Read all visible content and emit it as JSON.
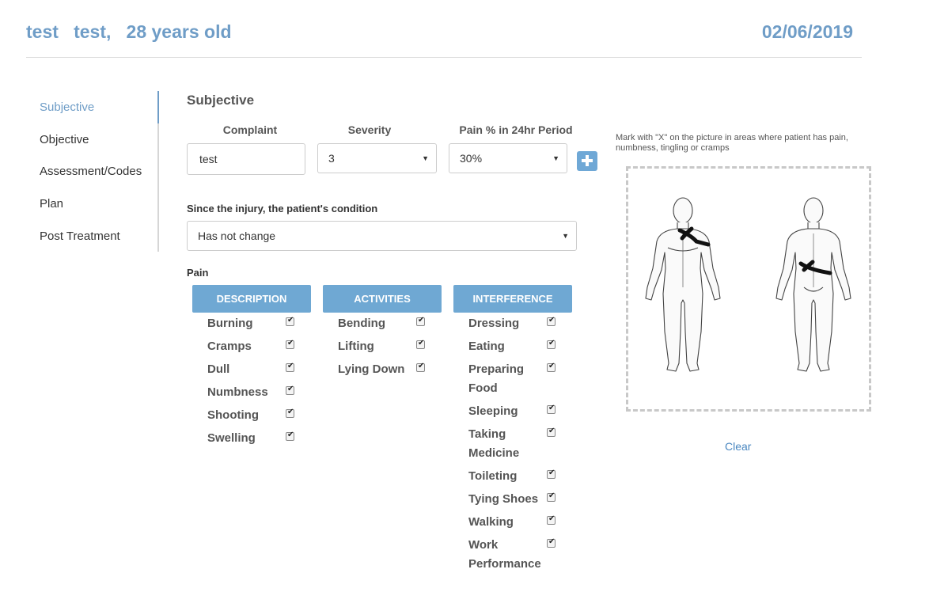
{
  "header": {
    "patient_name": "test   test,   28 years old",
    "visit_date": "02/06/2019"
  },
  "sidebar": {
    "items": [
      {
        "label": "Subjective",
        "active": true
      },
      {
        "label": "Objective",
        "active": false
      },
      {
        "label": "Assessment/Codes",
        "active": false
      },
      {
        "label": "Plan",
        "active": false
      },
      {
        "label": "Post Treatment",
        "active": false
      }
    ]
  },
  "subjective": {
    "title": "Subjective",
    "complaint_header": "Complaint",
    "severity_header": "Severity",
    "pain_percent_header": "Pain % in 24hr Period",
    "complaint_value": "test",
    "severity_value": "3",
    "pain_percent_value": "30%",
    "condition_label": "Since the injury, the patient's condition",
    "condition_value": "Has not change",
    "pain_label": "Pain"
  },
  "pain_categories": {
    "description": {
      "title": "DESCRIPTION",
      "items": [
        "Burning",
        "Cramps",
        "Dull",
        "Numbness",
        "Shooting",
        "Swelling"
      ]
    },
    "activities": {
      "title": "ACTIVITIES",
      "items": [
        "Bending",
        "Lifting",
        "Lying Down"
      ]
    },
    "interference": {
      "title": "INTERFERENCE",
      "items": [
        "Dressing",
        "Eating",
        "Preparing Food",
        "Sleeping",
        "Taking Medicine",
        "Toileting",
        "Tying Shoes",
        "Walking",
        "Work Performance"
      ]
    }
  },
  "body_chart": {
    "instruction": "Mark with \"X\" on the picture in areas where patient has pain, numbness, tingling or cramps",
    "clear_label": "Clear"
  },
  "colors": {
    "accent": "#6f9dc7",
    "category_header": "#6fa8d3",
    "add_button": "#6fa8d6"
  },
  "icons": {
    "add": "plus-icon",
    "dropdown": "caret-down-icon",
    "checkbox": "check-icon"
  }
}
